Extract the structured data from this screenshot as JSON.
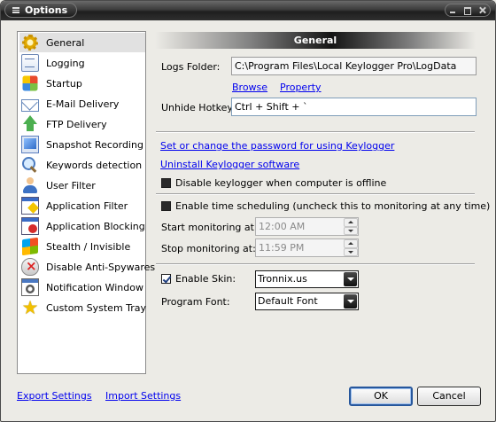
{
  "window": {
    "title": "Options"
  },
  "sidebar": {
    "items": [
      {
        "label": "General",
        "icon": "gear-icon",
        "selected": true
      },
      {
        "label": "Logging",
        "icon": "log-icon"
      },
      {
        "label": "Startup",
        "icon": "startup-icon"
      },
      {
        "label": "E-Mail Delivery",
        "icon": "email-icon"
      },
      {
        "label": "FTP Delivery",
        "icon": "upload-arrow-icon"
      },
      {
        "label": "Snapshot Recording",
        "icon": "snapshot-icon"
      },
      {
        "label": "Keywords detection",
        "icon": "magnifier-icon"
      },
      {
        "label": "User Filter",
        "icon": "user-icon"
      },
      {
        "label": "Application Filter",
        "icon": "app-filter-icon"
      },
      {
        "label": "Application Blocking",
        "icon": "app-block-icon"
      },
      {
        "label": "Stealth / Invisible",
        "icon": "windows-logo-icon"
      },
      {
        "label": "Disable Anti-Spywares",
        "icon": "shield-x-icon"
      },
      {
        "label": "Notification Window",
        "icon": "notification-window-icon"
      },
      {
        "label": "Custom System Tray",
        "icon": "star-icon"
      }
    ]
  },
  "general": {
    "header": "General",
    "logs_folder_label": "Logs Folder:",
    "logs_folder_value": "C:\\Program Files\\Local Keylogger Pro\\LogData",
    "browse_link": "Browse",
    "property_link": "Property",
    "hotkey_label": "Unhide Hotkey:",
    "hotkey_value": "Ctrl + Shift + `",
    "password_link": "Set or change the password for using Keylogger",
    "uninstall_link": "Uninstall Keylogger software",
    "disable_offline": {
      "label": "Disable keylogger when computer is offline",
      "checked": false
    },
    "time_scheduling": {
      "label": "Enable time scheduling (uncheck this to monitoring at any time)",
      "checked": false
    },
    "start_label": "Start monitoring at:",
    "start_value": "12:00 AM",
    "stop_label": "Stop monitoring at:",
    "stop_value": "11:59 PM",
    "enable_skin": {
      "label": "Enable Skin:",
      "checked": true
    },
    "skin_value": "Tronnix.us",
    "program_font_label": "Program Font:",
    "program_font_value": "Default Font"
  },
  "footer": {
    "export_link": "Export Settings",
    "import_link": "Import Settings",
    "ok_label": "OK",
    "cancel_label": "Cancel"
  }
}
